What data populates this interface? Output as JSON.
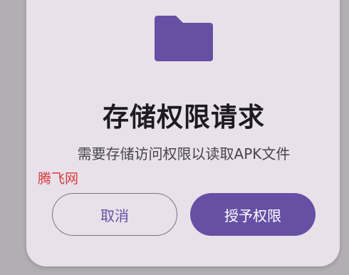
{
  "dialog": {
    "icon": "folder-icon",
    "title": "存储权限请求",
    "message": "需要存储访问权限以读取APK文件",
    "cancel_label": "取消",
    "confirm_label": "授予权限"
  },
  "watermark": {
    "text": "腾飞网"
  },
  "colors": {
    "accent": "#6750A4",
    "surface": "#E8E1EA",
    "scrim": "#B3AEB3"
  }
}
